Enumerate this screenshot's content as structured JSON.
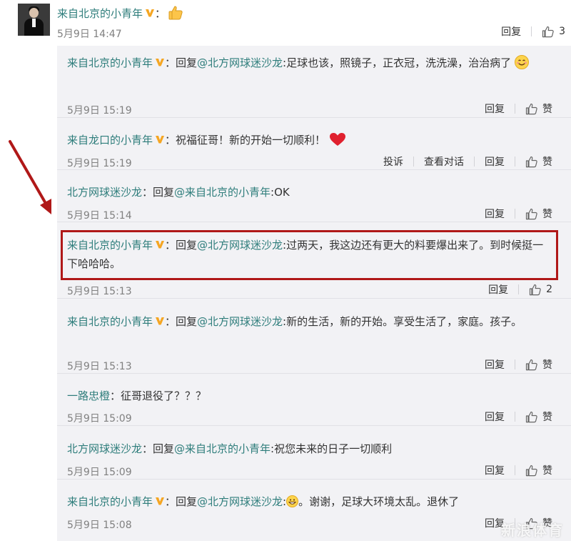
{
  "top_comment": {
    "username": "来自北京的小青年",
    "text": "：",
    "timestamp": "5月9日 14:47",
    "reply_label": "回复",
    "like_count": "3"
  },
  "replies": [
    {
      "username": "来自北京的小青年",
      "prefix": "：回复",
      "at": "@北方网球迷沙龙",
      "text": ":足球也该，照镜子，正衣冠，洗洗澡，治治病了",
      "timestamp": "5月9日 15:19",
      "reply_label": "回复",
      "like_label": "赞"
    },
    {
      "username": "来自龙口的小青年",
      "prefix": "：",
      "text": "祝福征哥！新的开始一切顺利！",
      "timestamp": "5月9日 15:19",
      "report_label": "投诉",
      "conversation_label": "查看对话",
      "reply_label": "回复",
      "like_label": "赞"
    },
    {
      "username": "北方网球迷沙龙",
      "prefix": "：回复",
      "at": "@来自北京的小青年",
      "text": ":OK",
      "timestamp": "5月9日 15:14",
      "reply_label": "回复",
      "like_label": "赞"
    },
    {
      "username": "来自北京的小青年",
      "prefix": "：回复",
      "at": "@北方网球迷沙龙",
      "text": ":过两天，我这边还有更大的料要爆出来了。到时候挺一下哈哈哈。",
      "timestamp": "5月9日 15:13",
      "reply_label": "回复",
      "like_count": "2"
    },
    {
      "username": "来自北京的小青年",
      "prefix": "：回复",
      "at": "@北方网球迷沙龙",
      "text": ":新的生活，新的开始。享受生活了，家庭。孩子。",
      "timestamp": "5月9日 15:13",
      "reply_label": "回复",
      "like_label": "赞"
    },
    {
      "username": "一路忠橙",
      "prefix": "：",
      "text": "征哥退役了？？？",
      "timestamp": "5月9日 15:09",
      "reply_label": "回复",
      "like_label": "赞"
    },
    {
      "username": "北方网球迷沙龙",
      "prefix": "：回复",
      "at": "@来自北京的小青年",
      "text": ":祝您未来的日子一切顺利",
      "timestamp": "5月9日 15:09",
      "reply_label": "回复",
      "like_label": "赞"
    },
    {
      "username": "来自北京的小青年",
      "prefix": "：回复",
      "at": "@北方网球迷沙龙",
      "text_before_emoji": ":",
      "text": "。谢谢，足球大环境太乱。退休了",
      "timestamp": "5月9日 15:08",
      "reply_label": "回复",
      "like_label": "赞"
    }
  ],
  "watermark": "新浪体育",
  "colors": {
    "username": "#2e7d7b",
    "reply_background": "#f2f2f5",
    "highlight": "#b01818",
    "verified_badge": "#f5a623",
    "heart": "#e0202e"
  }
}
